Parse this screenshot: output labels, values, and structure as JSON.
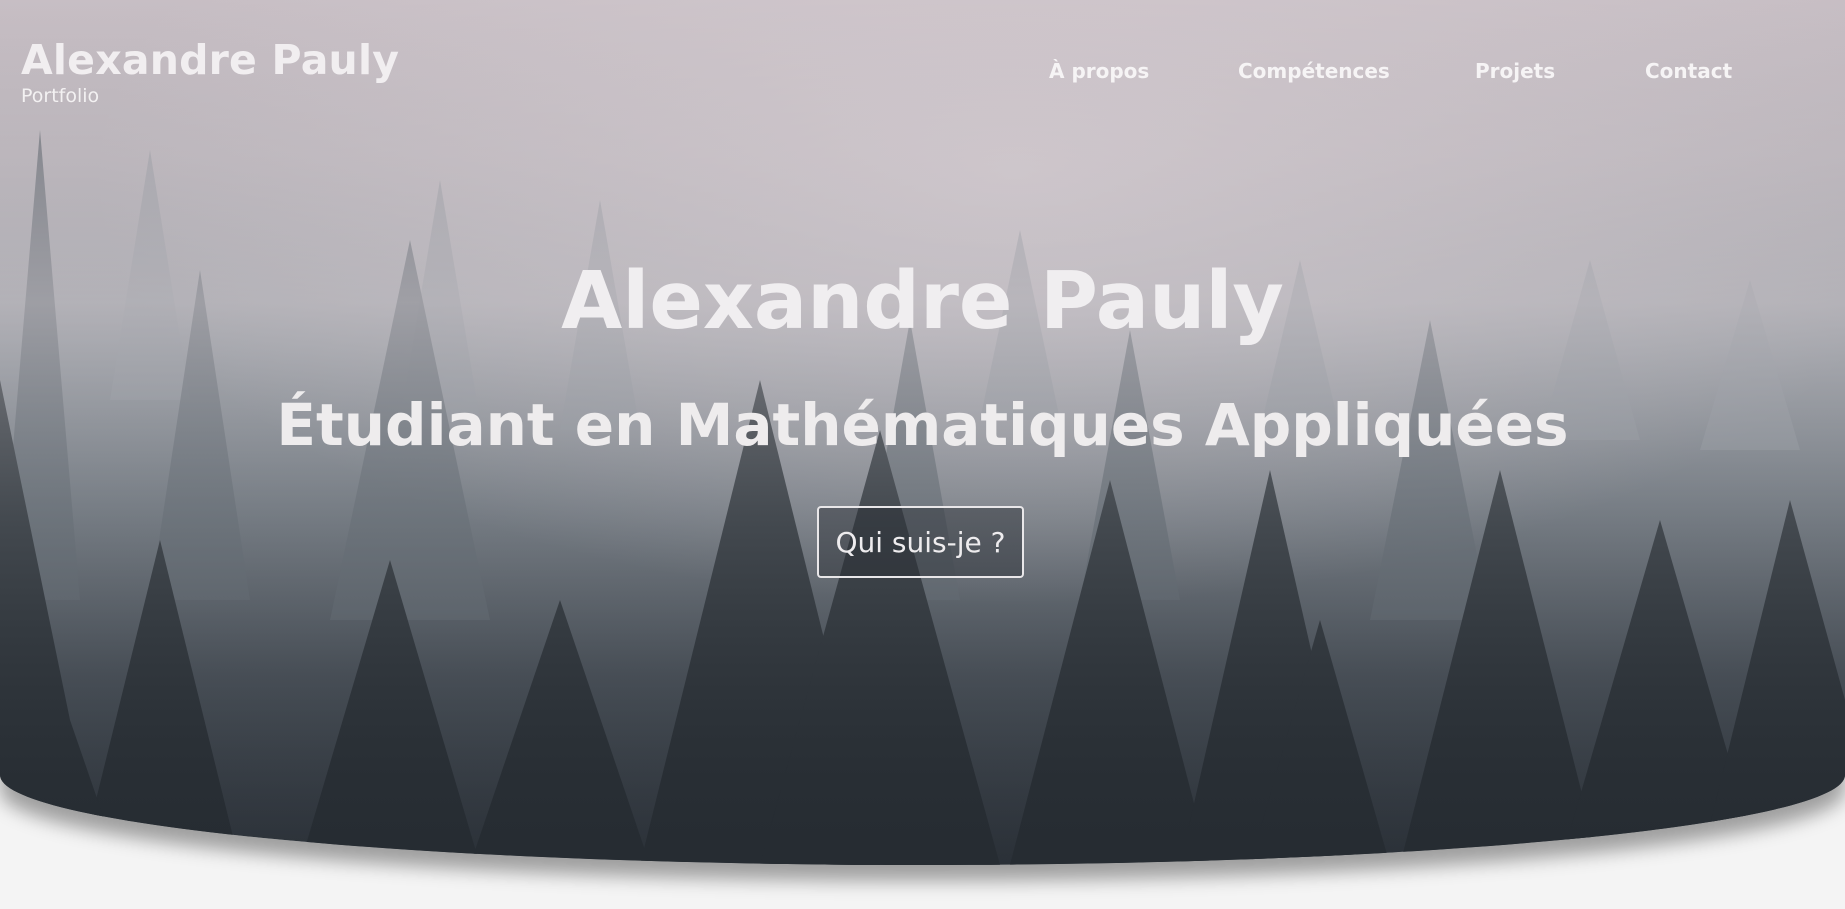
{
  "header": {
    "brand_name": "Alexandre Pauly",
    "brand_subtitle": "Portfolio"
  },
  "nav": {
    "items": [
      {
        "label": "À propos"
      },
      {
        "label": "Compétences"
      },
      {
        "label": "Projets"
      },
      {
        "label": "Contact"
      }
    ]
  },
  "hero": {
    "title": "Alexandre Pauly",
    "subtitle": "Étudiant en Mathématiques Appliquées",
    "cta_label": "Qui suis-je ?",
    "background": "misty-pine-forest"
  },
  "colors": {
    "page_background": "#f4f4f4",
    "sky": "#c7bec4",
    "forest_dark": "#2a3037",
    "text": "#f0eef0"
  }
}
